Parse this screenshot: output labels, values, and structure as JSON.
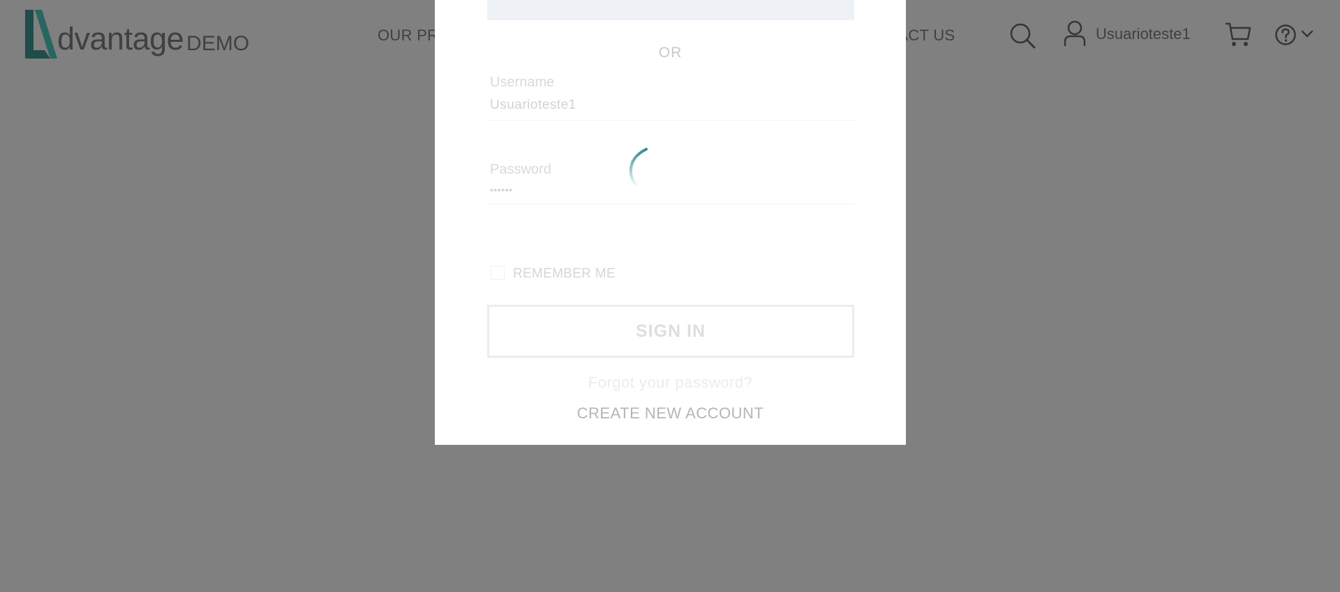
{
  "brand": {
    "logo_word": "dvantage",
    "logo_suffix": "DEMO",
    "accent_color": "#2f7f78"
  },
  "header": {
    "nav_left_label": "OUR PR",
    "nav_right_label": "NTACT US",
    "username": "Usuarioteste1",
    "icons": [
      "search-icon",
      "user-icon",
      "cart-icon",
      "help-icon",
      "chevron-down-icon"
    ]
  },
  "login_modal": {
    "facebook_button_label": "",
    "or_divider": "OR",
    "username": {
      "label": "Username",
      "value": "Usuarioteste1"
    },
    "password": {
      "label": "Password",
      "value": "••••••"
    },
    "remember_me_label": "REMEMBER ME",
    "sign_in_label": "SIGN IN",
    "forgot_password_label": "Forgot your password?",
    "create_account_label": "CREATE NEW ACCOUNT",
    "loading": true
  }
}
